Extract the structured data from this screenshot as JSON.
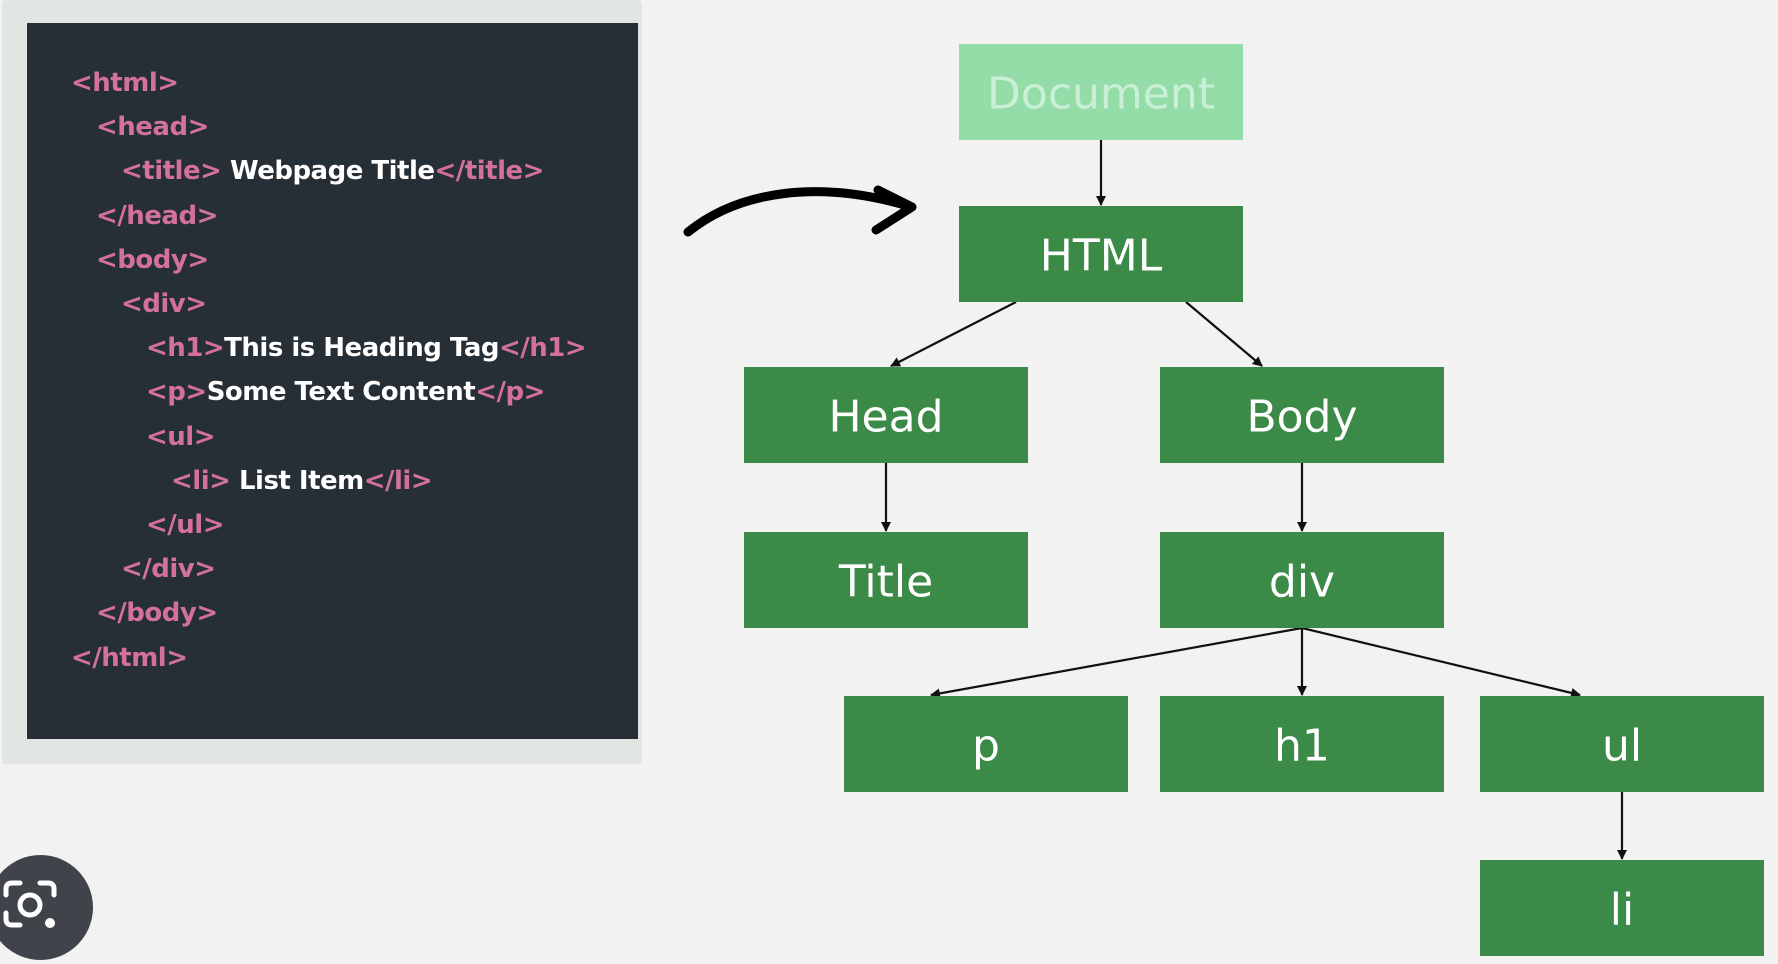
{
  "code_lines": [
    {
      "indent": 0,
      "parts": [
        {
          "t": "tag",
          "s": "<html>"
        }
      ]
    },
    {
      "indent": 1,
      "parts": [
        {
          "t": "tag",
          "s": "<head>"
        }
      ]
    },
    {
      "indent": 2,
      "parts": [
        {
          "t": "tag",
          "s": "<title>"
        },
        {
          "t": "txt",
          "s": " Webpage Title"
        },
        {
          "t": "tag",
          "s": "</title>"
        }
      ]
    },
    {
      "indent": 1,
      "parts": [
        {
          "t": "tag",
          "s": "</head>"
        }
      ]
    },
    {
      "indent": 1,
      "parts": [
        {
          "t": "tag",
          "s": "<body>"
        }
      ]
    },
    {
      "indent": 2,
      "parts": [
        {
          "t": "tag",
          "s": "<div>"
        }
      ]
    },
    {
      "indent": 3,
      "parts": [
        {
          "t": "tag",
          "s": "<h1>"
        },
        {
          "t": "txt",
          "s": "This is Heading Tag"
        },
        {
          "t": "tag",
          "s": "</h1>"
        }
      ]
    },
    {
      "indent": 3,
      "parts": [
        {
          "t": "tag",
          "s": "<p>"
        },
        {
          "t": "txt",
          "s": "Some Text Content"
        },
        {
          "t": "tag",
          "s": "</p>"
        }
      ]
    },
    {
      "indent": 3,
      "parts": [
        {
          "t": "tag",
          "s": "<ul>"
        }
      ]
    },
    {
      "indent": 4,
      "parts": [
        {
          "t": "tag",
          "s": "<li>"
        },
        {
          "t": "txt",
          "s": " List Item"
        },
        {
          "t": "tag",
          "s": "</li>"
        }
      ]
    },
    {
      "indent": 3,
      "parts": [
        {
          "t": "tag",
          "s": "</ul>"
        }
      ]
    },
    {
      "indent": 2,
      "parts": [
        {
          "t": "tag",
          "s": "</div>"
        }
      ]
    },
    {
      "indent": 1,
      "parts": [
        {
          "t": "tag",
          "s": "</body>"
        }
      ]
    },
    {
      "indent": 0,
      "parts": [
        {
          "t": "tag",
          "s": "</html>"
        }
      ]
    }
  ],
  "tree": {
    "nodes": [
      {
        "id": "document",
        "label": "Document"
      },
      {
        "id": "html",
        "label": "HTML"
      },
      {
        "id": "head",
        "label": "Head"
      },
      {
        "id": "body",
        "label": "Body"
      },
      {
        "id": "title",
        "label": "Title"
      },
      {
        "id": "div",
        "label": "div"
      },
      {
        "id": "p",
        "label": "p"
      },
      {
        "id": "h1",
        "label": "h1"
      },
      {
        "id": "ul",
        "label": "ul"
      },
      {
        "id": "li",
        "label": "li"
      }
    ],
    "edges": [
      [
        "document",
        "html"
      ],
      [
        "html",
        "head"
      ],
      [
        "html",
        "body"
      ],
      [
        "head",
        "title"
      ],
      [
        "body",
        "div"
      ],
      [
        "div",
        "p"
      ],
      [
        "div",
        "h1"
      ],
      [
        "div",
        "ul"
      ],
      [
        "ul",
        "li"
      ]
    ]
  },
  "colors": {
    "node_fill": "#3b8a47",
    "root_fill": "#94dda8",
    "root_text": "#c9efd7",
    "tag": "#d4709e",
    "text": "#ffffff",
    "panel": "#262e36",
    "arrow": "#111111"
  },
  "icons": {
    "lens": "camera-search-icon",
    "pointer": "curved-arrow-icon"
  }
}
